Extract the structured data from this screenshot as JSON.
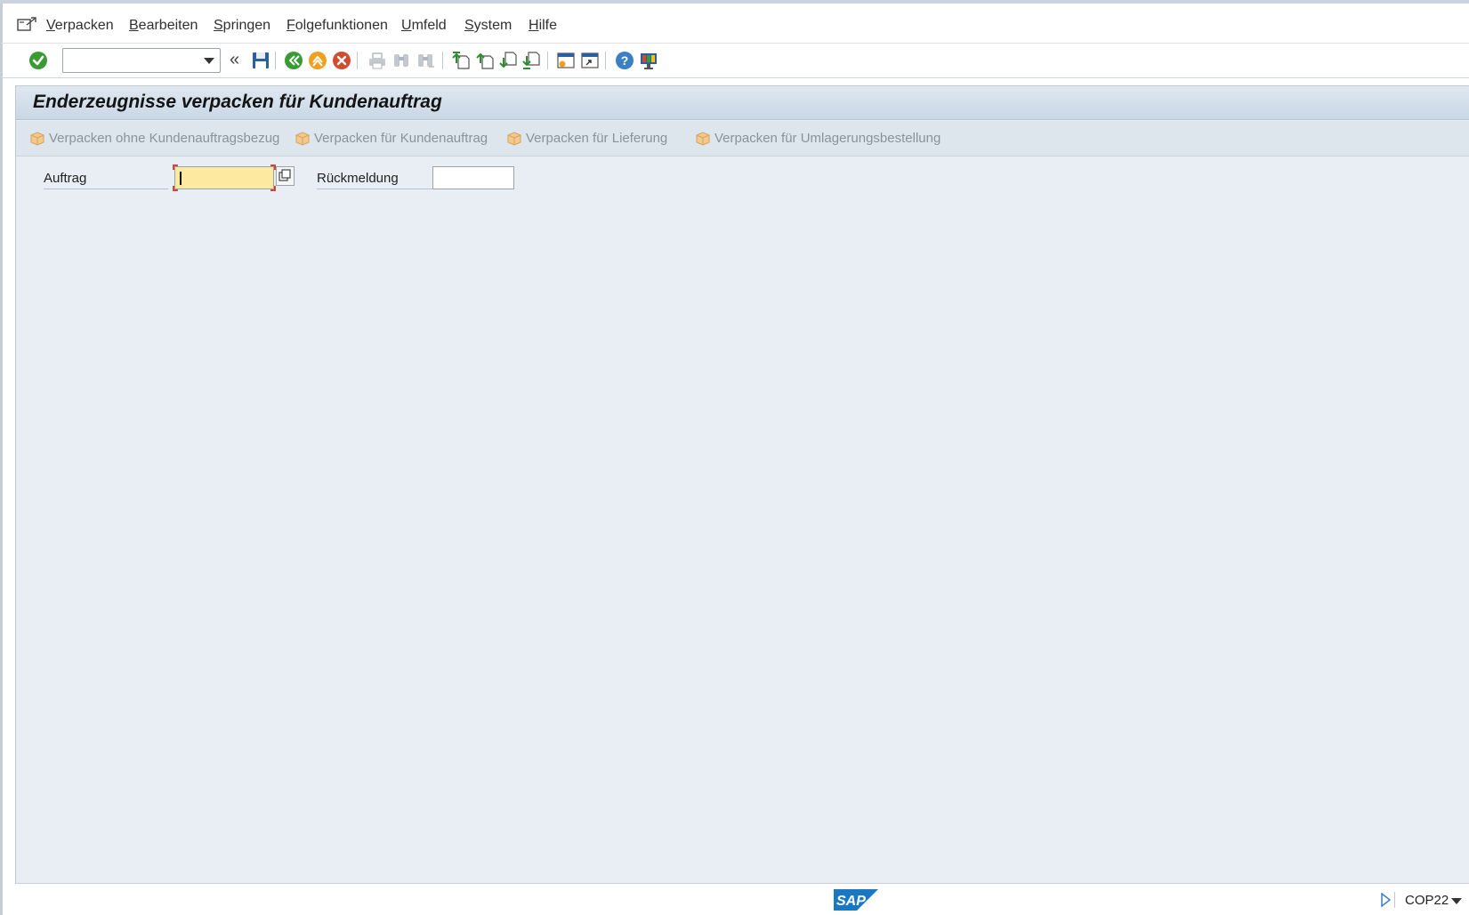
{
  "menubar": {
    "items": [
      {
        "first": "V",
        "rest": "erpacken"
      },
      {
        "first": "B",
        "rest": "earbeiten"
      },
      {
        "first": "S",
        "rest": "pringen"
      },
      {
        "first": "F",
        "rest": "olgefunktionen"
      },
      {
        "first": "U",
        "rest": "mfeld"
      },
      {
        "first": "S",
        "rest": "ystem"
      },
      {
        "first": "H",
        "rest": "ilfe"
      }
    ]
  },
  "toolbar": {
    "command_field_value": "",
    "collapse_glyph": "«",
    "icons": [
      "enter-icon",
      "save-icon",
      "back-icon",
      "exit-icon",
      "cancel-icon",
      "print-icon",
      "find-icon",
      "find-next-icon",
      "first-page-icon",
      "previous-page-icon",
      "next-page-icon",
      "last-page-icon",
      "create-session-icon",
      "create-shortcut-icon",
      "help-icon",
      "customize-layout-icon"
    ]
  },
  "screen": {
    "title": "Enderzeugnisse verpacken für Kundenauftrag",
    "app_buttons": [
      "Verpacken ohne Kundenauftragsbezug",
      "Verpacken für Kundenauftrag",
      "Verpacken für Lieferung",
      "Verpacken für Umlagerungsbestellung"
    ],
    "fields": {
      "auftrag_label": "Auftrag",
      "auftrag_value": "",
      "rueckmeldung_label": "Rückmeldung",
      "rueckmeldung_value": ""
    }
  },
  "statusbar": {
    "logo_text": "SAP",
    "transaction": "COP22"
  },
  "colors": {
    "main_background": "#e8eef4",
    "title_gradient_top": "#dfe8f1",
    "title_gradient_bottom": "#c9d7e5",
    "required_field": "#fdeaa0",
    "sap_blue": "#1a78c2"
  }
}
